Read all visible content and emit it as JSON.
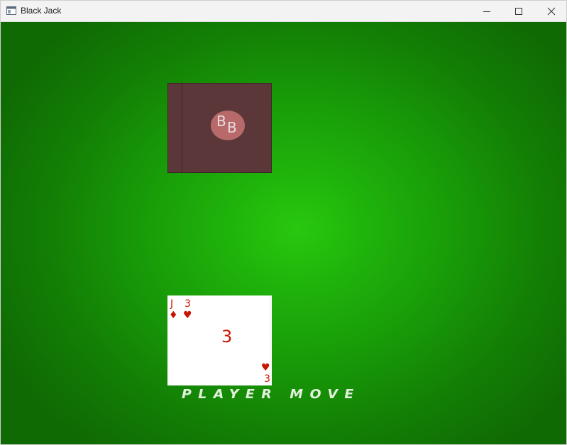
{
  "window": {
    "title": "Black Jack",
    "icon": "window-app-icon",
    "controls": {
      "minimize_icon": "minimize-icon",
      "maximize_icon": "maximize-icon",
      "close_icon": "close-icon"
    }
  },
  "colors": {
    "felt_center": "#28c80e",
    "felt_edge": "#0f6a03",
    "card_back": "#5b3739",
    "card_back_logo": "#b86a6b",
    "card_red": "#c81400",
    "status_text": "#e4f0de"
  },
  "dealer": {
    "cards": [
      {
        "face_down": true,
        "logo_left": "B",
        "logo_right": "B"
      }
    ]
  },
  "player": {
    "cards": [
      {
        "tl_rank_1": "J",
        "tl_suit_1": "♦",
        "tl_rank_2": "3",
        "tl_suit_2": "♥",
        "center_rank": "3",
        "br_suit": "♥",
        "br_rank": "3"
      }
    ]
  },
  "status": {
    "message": "PLAYER MOVE"
  }
}
